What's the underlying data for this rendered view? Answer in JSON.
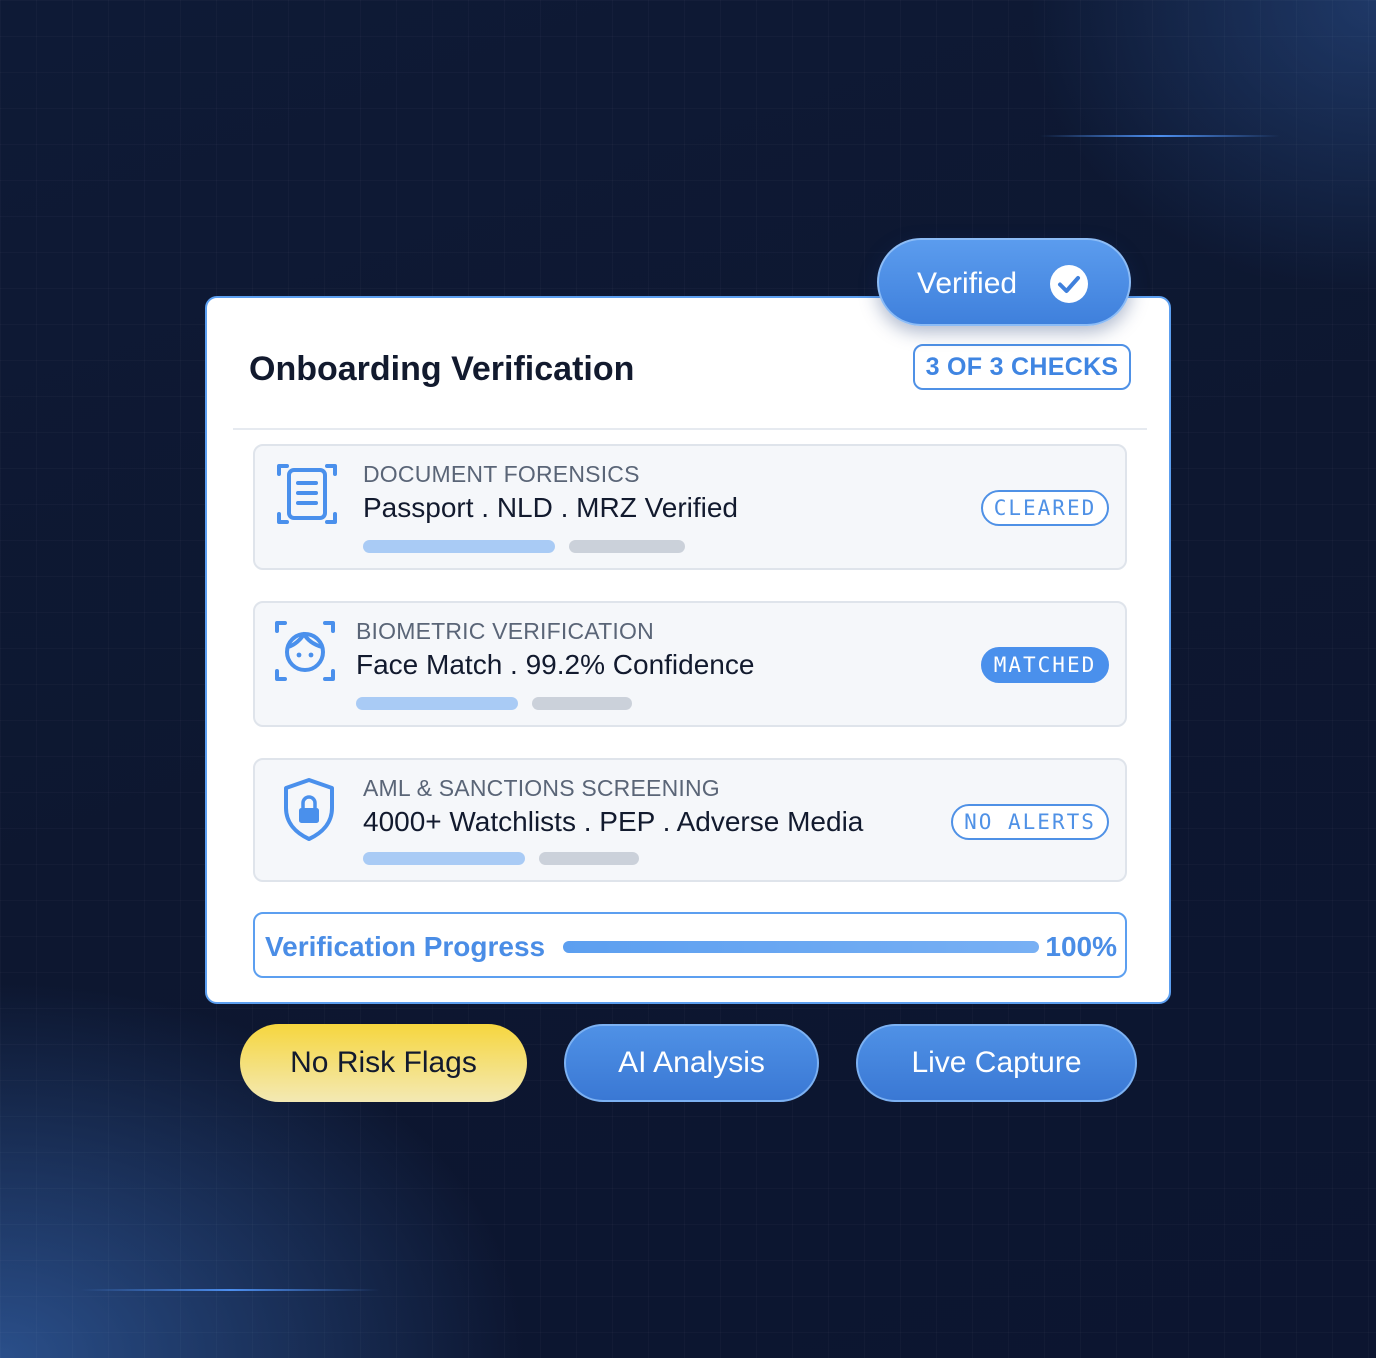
{
  "card": {
    "title": "Onboarding Verification",
    "checks_badge": "3 OF 3 CHECKS",
    "verified_badge": {
      "label": "Verified",
      "icon": "check-circle-icon"
    }
  },
  "checks": [
    {
      "category": "DOCUMENT FORENSICS",
      "title": "Passport . NLD .  MRZ Verified",
      "status": "CLEARED",
      "status_style": "outline",
      "icon": "document-scan-icon"
    },
    {
      "category": "BIOMETRIC VERIFICATION",
      "title": "Face Match . 99.2% Confidence",
      "status": "MATCHED",
      "status_style": "filled",
      "icon": "face-scan-icon"
    },
    {
      "category": "AML & SANCTIONS SCREENING",
      "title": "4000+ Watchlists . PEP . Adverse Media",
      "status": "NO ALERTS",
      "status_style": "outline",
      "icon": "shield-lock-icon"
    }
  ],
  "progress": {
    "label": "Verification Progress",
    "percent_label": "100%",
    "value": 1.0
  },
  "chips": {
    "risk": "No Risk Flags",
    "ai": "AI Analysis",
    "live": "Live Capture"
  },
  "colors": {
    "accent": "#4a90ec",
    "highlight": "#f6d63e",
    "background": "#0d1730"
  }
}
